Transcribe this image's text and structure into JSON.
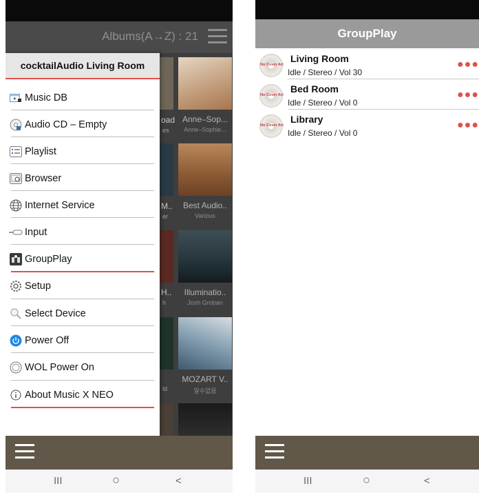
{
  "left": {
    "header_title": "Albums(A→Z) : 21",
    "drawer_title": "cocktailAudio Living Room",
    "menu": [
      {
        "label": "Music DB",
        "icon": "music-db-icon"
      },
      {
        "label": "Audio CD – Empty",
        "icon": "audio-cd-icon"
      },
      {
        "label": "Playlist",
        "icon": "playlist-icon"
      },
      {
        "label": "Browser",
        "icon": "browser-icon"
      },
      {
        "label": "Internet Service",
        "icon": "globe-icon"
      },
      {
        "label": "Input",
        "icon": "input-icon"
      },
      {
        "label": "GroupPlay",
        "icon": "groupplay-icon"
      },
      {
        "label": "Setup",
        "icon": "gear-icon"
      },
      {
        "label": "Select Device",
        "icon": "search-icon"
      },
      {
        "label": "Power Off",
        "icon": "power-icon"
      },
      {
        "label": "WOL Power On",
        "icon": "wol-icon"
      },
      {
        "label": "About Music X NEO",
        "icon": "info-icon"
      }
    ],
    "albums": [
      {
        "title": "Anne–Sop...",
        "artist": "Anne–Sophie..."
      },
      {
        "title": "Best Audio..",
        "artist": "Various"
      },
      {
        "title": "Illuminatio..",
        "artist": "Josh Groban"
      },
      {
        "title": "MOZART V..",
        "artist": "알수없음"
      }
    ],
    "covered_col": [
      {
        "title": "oad",
        "artist": "es"
      },
      {
        "title": "M..",
        "artist": "er"
      },
      {
        "title": "H..",
        "artist": "h"
      },
      {
        "title": "",
        "artist": "ld"
      }
    ]
  },
  "right": {
    "header_title": "GroupPlay",
    "no_cover_text": "No Cover Art",
    "devices": [
      {
        "name": "Living Room",
        "status": "Idle / Stereo / Vol 30"
      },
      {
        "name": "Bed Room",
        "status": "Idle / Stereo / Vol 0"
      },
      {
        "name": "Library",
        "status": "Idle / Stereo / Vol 0"
      }
    ]
  },
  "nav": {
    "recents": "III",
    "home": "○",
    "back": "<"
  },
  "colors": {
    "accent_red": "#e0504a",
    "bottom_bar": "#625849",
    "power_blue": "#1e88e5"
  }
}
